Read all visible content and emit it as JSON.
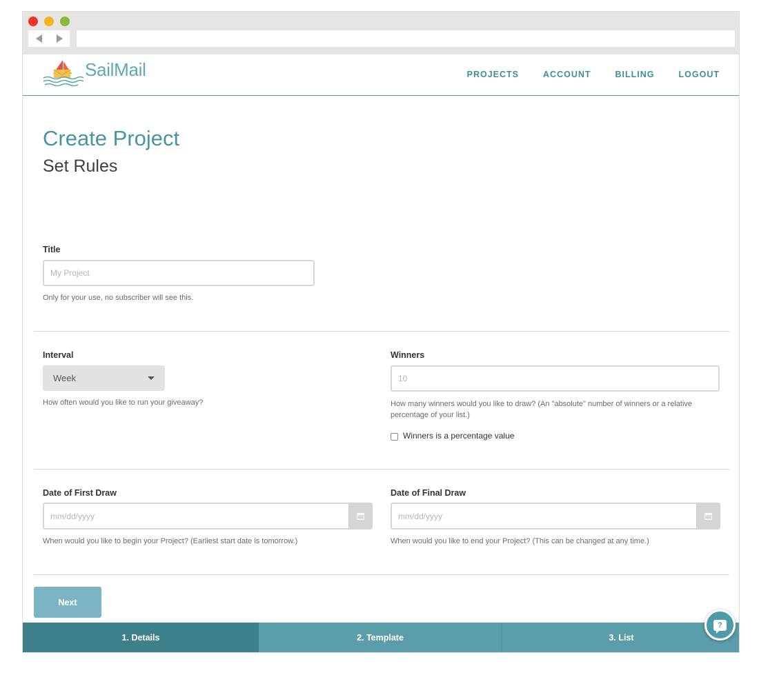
{
  "brand": {
    "name": "SailMail",
    "accent": "#4a94a1"
  },
  "nav": {
    "items": [
      "PROJECTS",
      "ACCOUNT",
      "BILLING",
      "LOGOUT"
    ]
  },
  "page": {
    "title": "Create Project",
    "subtitle": "Set Rules"
  },
  "form": {
    "title": {
      "label": "Title",
      "placeholder": "My Project",
      "help": "Only for your use, no subscriber will see this."
    },
    "interval": {
      "label": "Interval",
      "selected": "Week",
      "help": "How often would you like to run your giveaway?"
    },
    "winners": {
      "label": "Winners",
      "placeholder": "10",
      "help": "How many winners would you like to draw? (An \"absolute\" number of winners or a relative percentage of your list.)",
      "checkbox_label": "Winners is a percentage value",
      "checked": false
    },
    "first_draw": {
      "label": "Date of First Draw",
      "placeholder": "mm/dd/yyyy",
      "help": "When would you like to begin your Project? (Earliest start date is tomorrow.)"
    },
    "final_draw": {
      "label": "Date of Final Draw",
      "placeholder": "mm/dd/yyyy",
      "help": "When would you like to end your Project? (This can be changed at any time.)"
    },
    "next_label": "Next"
  },
  "steps": [
    {
      "label": "1. Details",
      "active": true
    },
    {
      "label": "2. Template",
      "active": false
    },
    {
      "label": "3. List",
      "active": false
    }
  ],
  "help_widget": {
    "icon": "help-chat-icon",
    "glyph": "?"
  }
}
